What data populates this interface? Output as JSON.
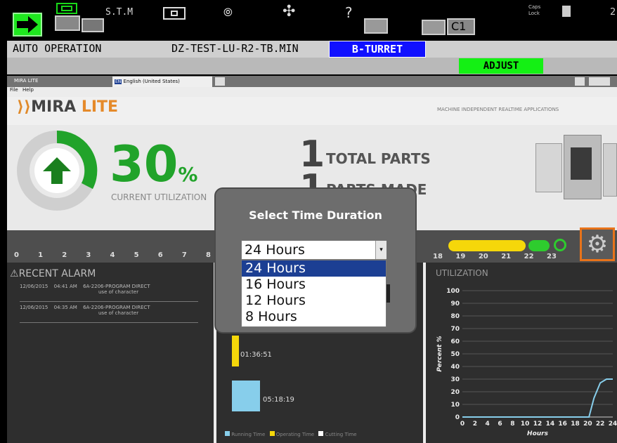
{
  "cnc": {
    "mode_label": "S.T.M",
    "caps_label_line1": "Caps",
    "caps_label_line2": "Lock",
    "c1_label": "C1",
    "question_label": "?",
    "corner_digit": "2",
    "status": {
      "operation": "AUTO OPERATION",
      "program": "DZ-TEST-LU-R2-TB.MIN",
      "turret": "B-TURRET",
      "adjust": "ADJUST"
    }
  },
  "window": {
    "title": "MIRA LITE",
    "language": "English (United States)",
    "language_code": "EN",
    "menu": [
      "File",
      "Help"
    ]
  },
  "mira": {
    "logo_main": "MIRA",
    "logo_sub": "LITE",
    "tagline": "MACHINE INDEPENDENT REALTIME APPLICATIONS",
    "utilization_value": "30",
    "utilization_unit": "%",
    "utilization_label": "CURRENT UTILIZATION",
    "total_parts_value": "1",
    "total_parts_label": "TOTAL PARTS",
    "parts_made_value": "1",
    "parts_made_label": "PARTS MADE",
    "timeline_left_ticks": [
      "0",
      "1",
      "2",
      "3",
      "4",
      "5",
      "6",
      "7",
      "8"
    ],
    "timeline_right_ticks": [
      "18",
      "19",
      "20",
      "21",
      "22",
      "23"
    ],
    "alarm_title": "RECENT ALARM",
    "alarms": [
      {
        "date": "12/06/2015",
        "time": "04:41 AM",
        "message": "6A-2206-PROGRAM DIRECT",
        "detail": "use of character"
      },
      {
        "date": "12/06/2015",
        "time": "04:35 AM",
        "message": "6A-2206-PROGRAM DIRECT",
        "detail": "use of character"
      }
    ],
    "operating_time": "01:36:51",
    "running_time": "05:18:19",
    "legend": [
      "Running Time",
      "Operating Time",
      "Cutting Time"
    ],
    "utilization_panel_title": "UTILIZATION"
  },
  "dialog": {
    "title": "Select Time Duration",
    "selected_value": "24 Hours",
    "options": [
      "24 Hours",
      "16 Hours",
      "12 Hours",
      "8 Hours"
    ],
    "highlighted_index": 0
  },
  "chart_data": {
    "type": "line",
    "title": "",
    "xlabel": "Hours",
    "ylabel": "Percent %",
    "x_ticks": [
      "0",
      "2",
      "4",
      "6",
      "8",
      "10",
      "12",
      "14",
      "16",
      "18",
      "20",
      "22",
      "24"
    ],
    "y_ticks": [
      "0",
      "10",
      "20",
      "30",
      "40",
      "50",
      "60",
      "70",
      "80",
      "90",
      "100"
    ],
    "xlim": [
      0,
      24
    ],
    "ylim": [
      0,
      100
    ],
    "series": [
      {
        "x": [
          0,
          20.2,
          21,
          22,
          23,
          24
        ],
        "y": [
          0,
          0,
          15,
          27,
          30,
          30
        ]
      }
    ],
    "color": "#87ceeb"
  },
  "colors": {
    "green_accent": "#21a32a",
    "orange_gear": "#e8731a",
    "turret_blue": "#1010ff",
    "adjust_green": "#14f014"
  }
}
